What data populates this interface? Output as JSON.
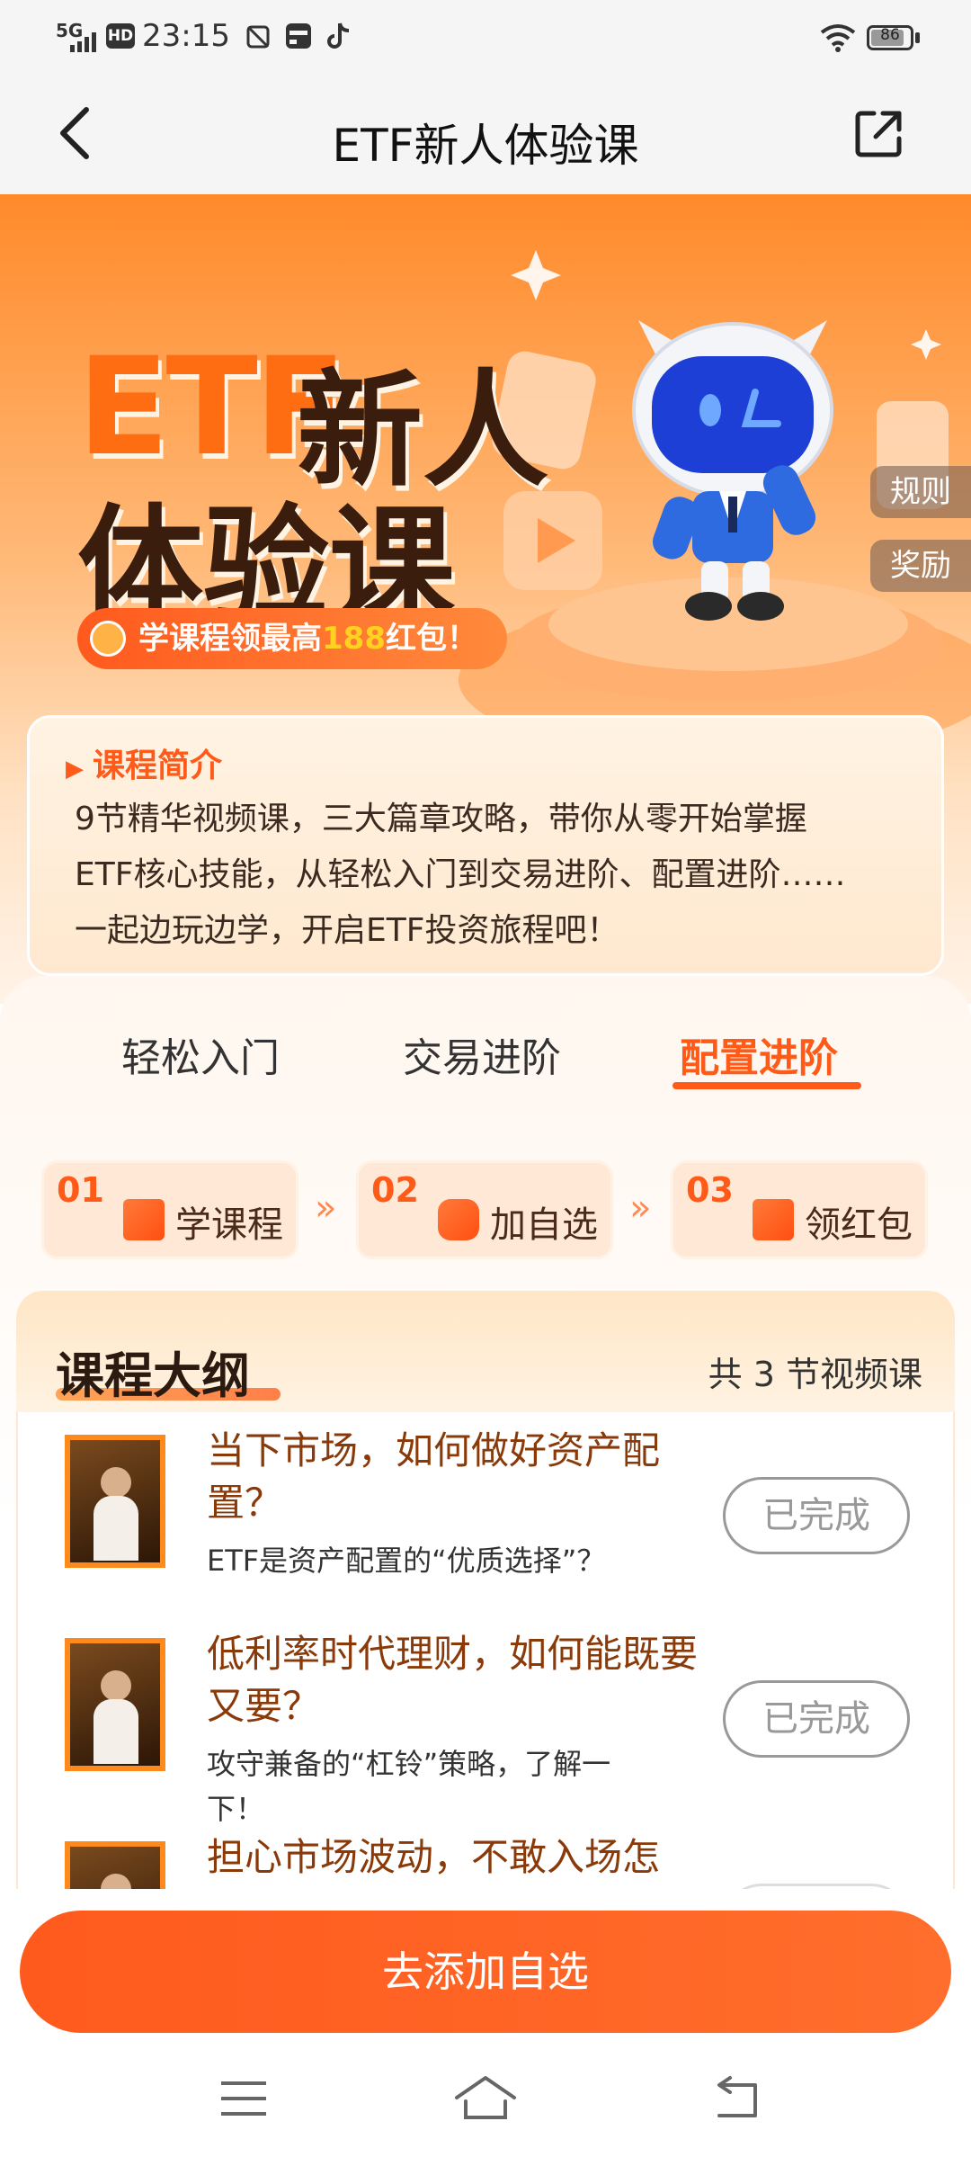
{
  "status_bar": {
    "network": "5G",
    "hd": "HD",
    "time": "23:15",
    "battery": "86"
  },
  "nav": {
    "title": "ETF新人体验课"
  },
  "hero": {
    "title_etf": "ETF",
    "title_line1": "新人",
    "title_line2": "体验课",
    "promo_prefix": "学课程领最高",
    "promo_amount": "188",
    "promo_suffix": "红包！",
    "side_rules": "规则",
    "side_reward": "奖励"
  },
  "intro": {
    "heading": "课程简介",
    "lines": [
      "9节精华视频课，三大篇章攻略，带你从零开始掌握",
      "ETF核心技能，从轻松入门到交易进阶、配置进阶……",
      "一起边玩边学，开启ETF投资旅程吧！"
    ]
  },
  "tabs": [
    {
      "label": "轻松入门",
      "active": false
    },
    {
      "label": "交易进阶",
      "active": false
    },
    {
      "label": "配置进阶",
      "active": true
    }
  ],
  "steps": [
    {
      "num": "01",
      "label": "学课程",
      "icon": "book-icon"
    },
    {
      "num": "02",
      "label": "加自选",
      "icon": "tap-icon"
    },
    {
      "num": "03",
      "label": "领红包",
      "icon": "gift-icon"
    }
  ],
  "step_arrow": "»",
  "outline": {
    "title": "课程大纲",
    "count": "共 3 节视频课"
  },
  "lessons": [
    {
      "title": "当下市场，如何做好资产配置？",
      "subtitle": "ETF是资产配置的“优质选择”？",
      "status": "已完成"
    },
    {
      "title": "低利率时代理财，如何能既要又要？",
      "subtitle": "攻守兼备的“杠铃”策略，了解一下！",
      "status": "已完成"
    },
    {
      "title": "担心市场波动，不敢入场怎",
      "subtitle": "",
      "status": ""
    }
  ],
  "cta": {
    "label": "去添加自选"
  },
  "colors": {
    "accent": "#ff5a18",
    "hero_top": "#ff8a2a",
    "done_border": "#999999"
  }
}
